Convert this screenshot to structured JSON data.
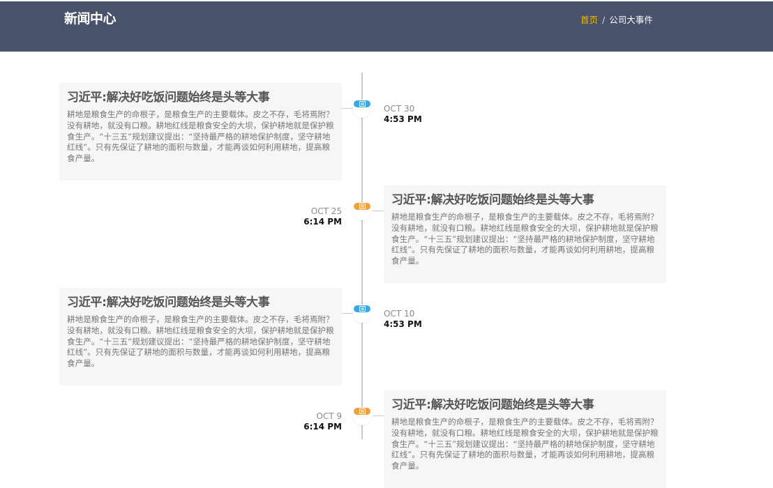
{
  "header": {
    "title": "新闻中心",
    "breadcrumb": {
      "home": "首页",
      "separator": "/",
      "current": "公司大事件"
    }
  },
  "colors": {
    "header_bg": "#49526b",
    "breadcrumb_active": "#f5b800",
    "node_blue": "#3ba9e0",
    "node_orange": "#f0a03c"
  },
  "timeline": [
    {
      "side": "left",
      "node_color": "blue",
      "icon": "document-icon",
      "date": "OCT 30",
      "time": "4:53 PM",
      "title": "习近平:解决好吃饭问题始终是头等大事",
      "body": "耕地是粮食生产的命根子，是粮食生产的主要载体。皮之不存，毛将焉附？没有耕地，就没有口粮。耕地红线是粮食安全的大坝，保护耕地就是保护粮食生产。“十三五”规划建议提出：“坚持最严格的耕地保护制度，坚守耕地红线”。只有先保证了耕地的面积与数量，才能再谈如何利用耕地，提高粮食产量。"
    },
    {
      "side": "right",
      "node_color": "orange",
      "icon": "document-icon",
      "date": "OCT 25",
      "time": "6:14 PM",
      "title": "习近平:解决好吃饭问题始终是头等大事",
      "body": "耕地是粮食生产的命根子，是粮食生产的主要载体。皮之不存，毛将焉附？没有耕地，就没有口粮。耕地红线是粮食安全的大坝，保护耕地就是保护粮食生产。“十三五”规划建议提出：“坚持最严格的耕地保护制度，坚守耕地红线”。只有先保证了耕地的面积与数量，才能再谈如何利用耕地，提高粮食产量。"
    },
    {
      "side": "left",
      "node_color": "blue",
      "icon": "document-icon",
      "date": "OCT 10",
      "time": "4:53 PM",
      "title": "习近平:解决好吃饭问题始终是头等大事",
      "body": "耕地是粮食生产的命根子，是粮食生产的主要载体。皮之不存，毛将焉附？没有耕地，就没有口粮。耕地红线是粮食安全的大坝，保护耕地就是保护粮食生产。“十三五”规划建议提出：“坚持最严格的耕地保护制度，坚守耕地红线”。只有先保证了耕地的面积与数量，才能再谈如何利用耕地，提高粮食产量。"
    },
    {
      "side": "right",
      "node_color": "orange",
      "icon": "document-icon",
      "date": "OCT 9",
      "time": "6:14 PM",
      "title": "习近平:解决好吃饭问题始终是头等大事",
      "body": "耕地是粮食生产的命根子，是粮食生产的主要载体。皮之不存，毛将焉附？没有耕地，就没有口粮。耕地红线是粮食安全的大坝，保护耕地就是保护粮食生产。“十三五”规划建议提出：“坚持最严格的耕地保护制度，坚守耕地红线”。只有先保证了耕地的面积与数量，才能再谈如何利用耕地，提高粮食产量。"
    }
  ]
}
